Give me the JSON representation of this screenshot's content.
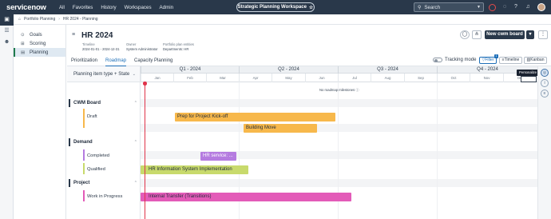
{
  "topnav": {
    "logo": "servicenow",
    "menu": [
      "All",
      "Favorites",
      "History",
      "Workspaces",
      "Admin"
    ],
    "workspace": "Strategic Planning Workspace",
    "search_label": "Search"
  },
  "breadcrumb": [
    "Portfolio Planning",
    "HR 2024 - Planning"
  ],
  "sidebar": {
    "items": [
      {
        "label": "Goals",
        "icon": "target-icon"
      },
      {
        "label": "Scoring",
        "icon": "scoring-icon"
      },
      {
        "label": "Planning",
        "icon": "planning-icon",
        "selected": true
      }
    ]
  },
  "header": {
    "title": "HR 2024",
    "meta": [
      {
        "label": "Timeline",
        "value": "2024-01-01 - 2024-12-31"
      },
      {
        "label": "Owner",
        "value": "System Administrator"
      },
      {
        "label": "Portfolio plan entities",
        "value": "Departments: HR"
      }
    ],
    "new_button": "New cwm board"
  },
  "tabs": {
    "items": [
      "Prioritization",
      "Roadmap",
      "Capacity Planning"
    ],
    "active": "Roadmap"
  },
  "toolbar": {
    "tracking_label": "Tracking mode",
    "filter_label": "Filter",
    "filter_count": "1",
    "timeline_label": "Timeline",
    "kanban_label": "Kanban",
    "tooltip": "Personalize"
  },
  "grouping": {
    "header": "Planning item type + State",
    "groups": [
      {
        "label": "CWM Board",
        "states": [
          "Draft"
        ]
      },
      {
        "label": "Demand",
        "states": [
          "Completed",
          "Qualified"
        ]
      },
      {
        "label": "Project",
        "states": [
          "Work in Progress"
        ]
      }
    ]
  },
  "timeline": {
    "quarters": [
      "Q1 - 2024",
      "Q2 - 2024",
      "Q3 - 2024",
      "Q4 - 2024"
    ],
    "months": [
      "Jan",
      "Feb",
      "Mar",
      "Apr",
      "May",
      "Jun",
      "Jul",
      "Aug",
      "Sep",
      "Oct",
      "Nov",
      "Dec"
    ],
    "no_milestones": "No roadmap milestones",
    "items": [
      {
        "label": "Prep for Project Kick-off",
        "color": "#f7b84b"
      },
      {
        "label": "Building Move",
        "color": "#f7b84b"
      },
      {
        "label": "HR service: ...",
        "color": "#b57be0"
      },
      {
        "label": "HR Information System Implementation",
        "color": "#c8da6c"
      },
      {
        "label": "Internal Transfer (Transitions)",
        "color": "#e35bb8"
      }
    ]
  }
}
